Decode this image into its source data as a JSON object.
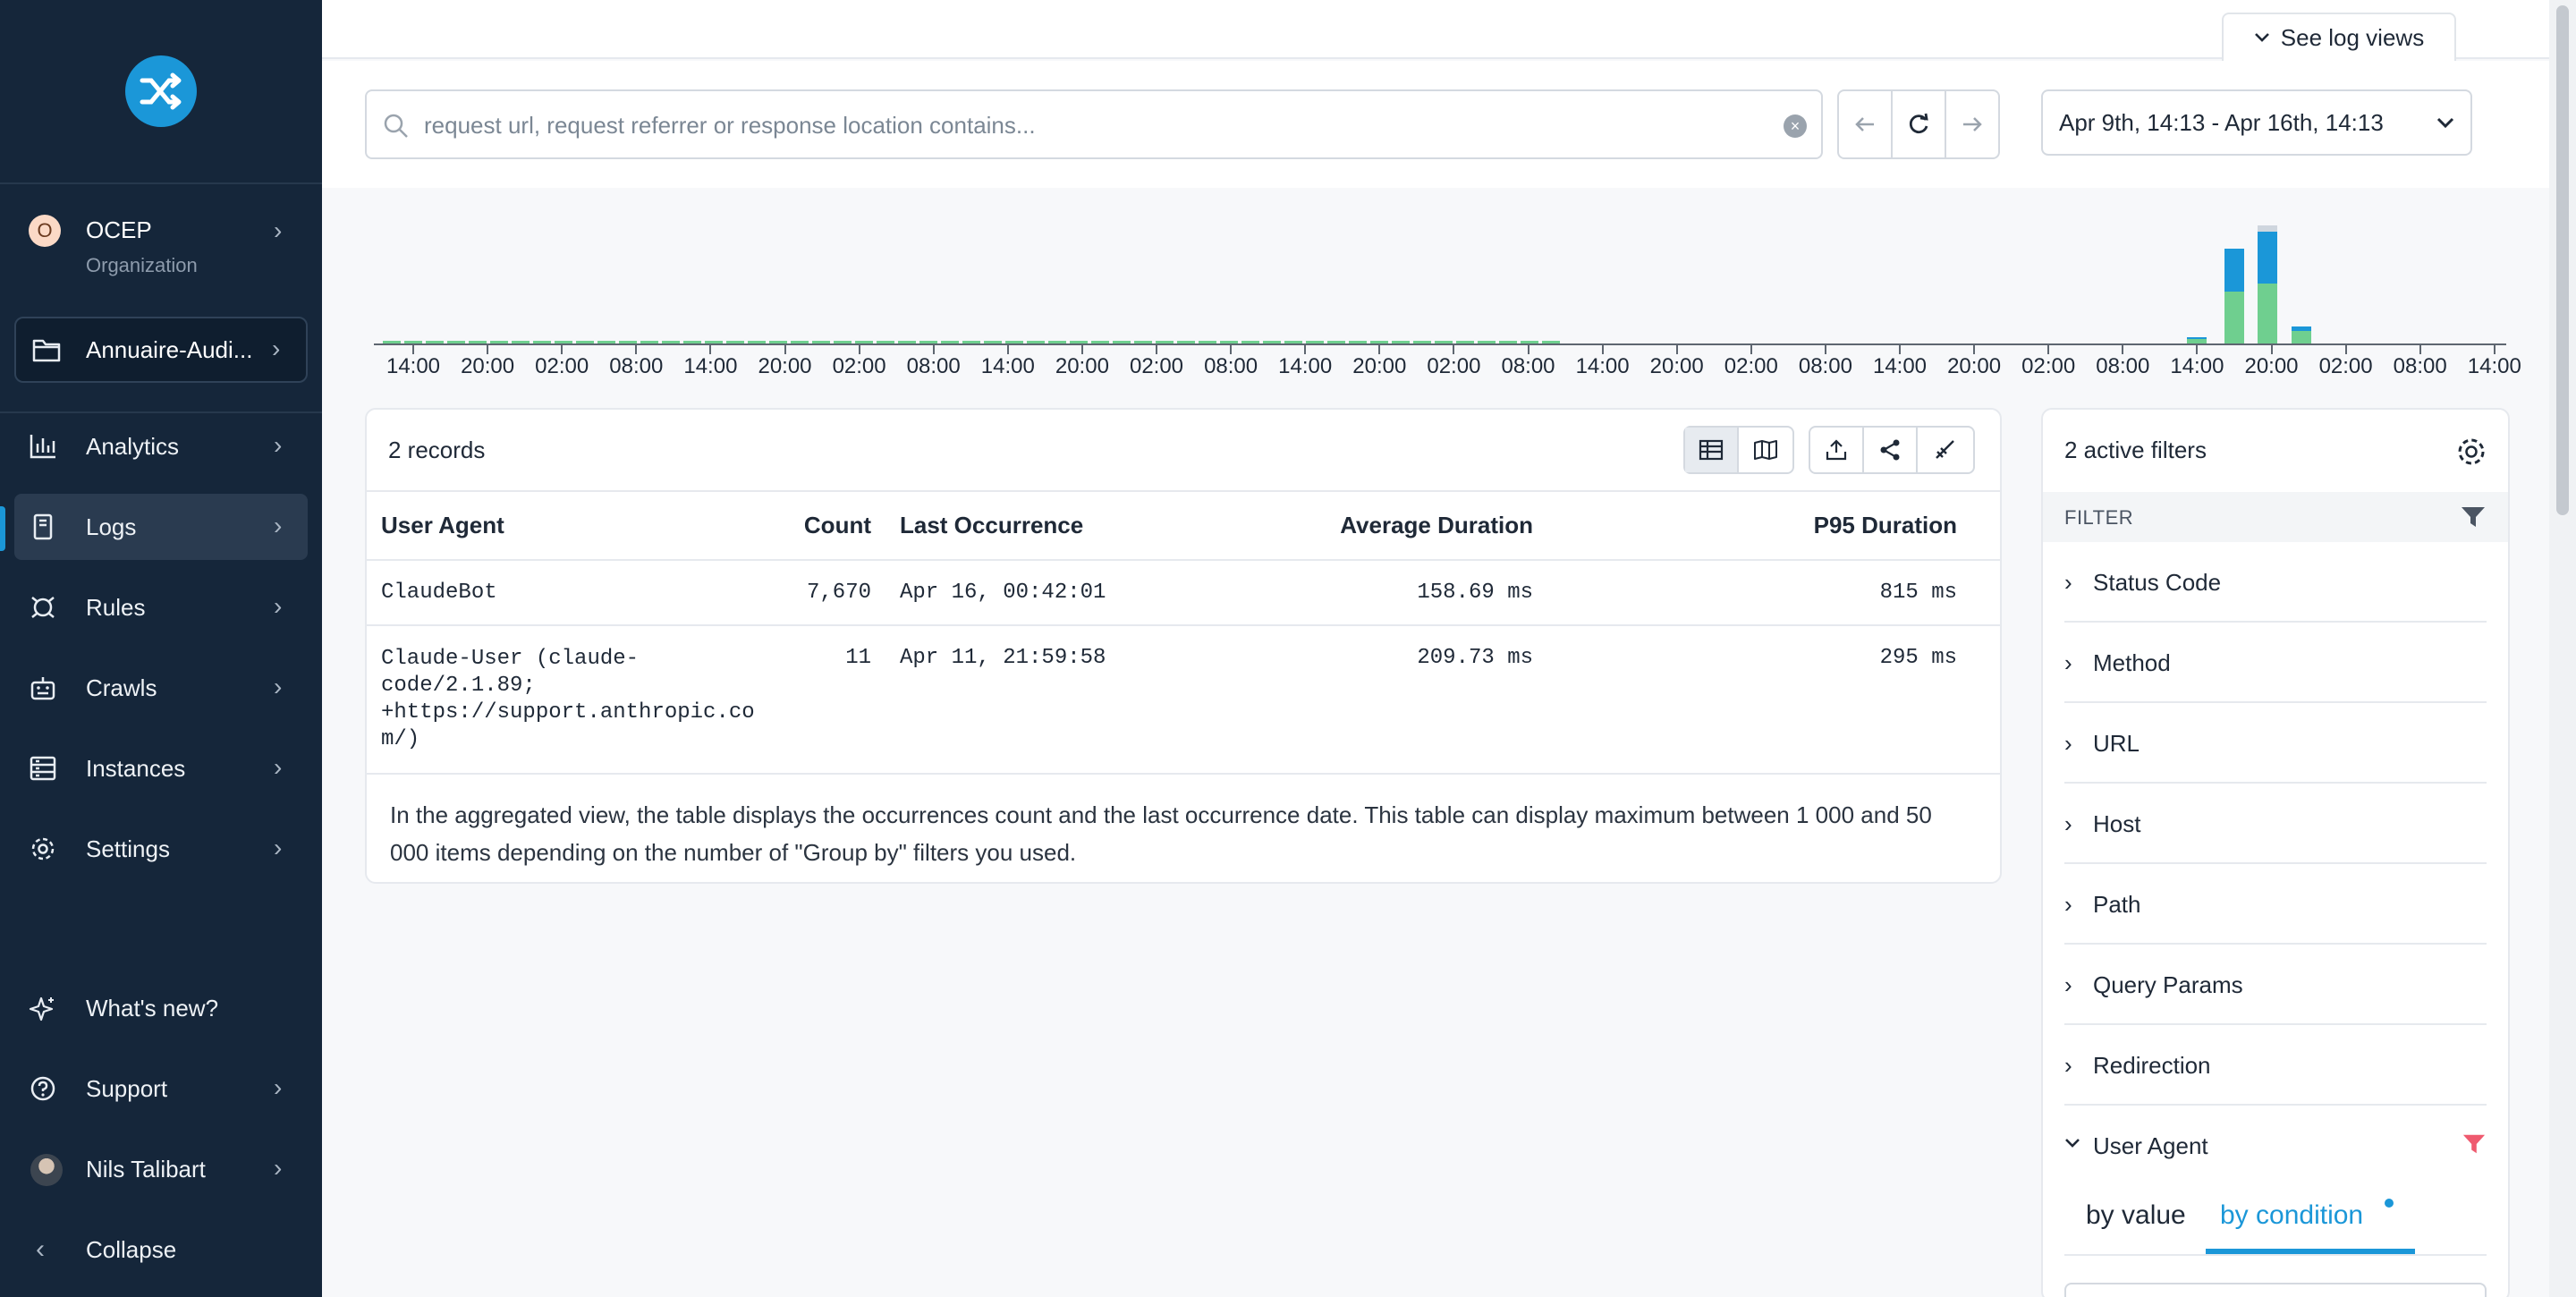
{
  "sidebar": {
    "org": {
      "badge": "O",
      "name": "OCEP",
      "sub": "Organization"
    },
    "project": {
      "label": "Annuaire-Audi..."
    },
    "items": [
      {
        "label": "Analytics",
        "icon": "bar-chart-icon"
      },
      {
        "label": "Logs",
        "icon": "log-file-icon"
      },
      {
        "label": "Rules",
        "icon": "rules-icon"
      },
      {
        "label": "Crawls",
        "icon": "robot-icon"
      },
      {
        "label": "Instances",
        "icon": "server-icon"
      },
      {
        "label": "Settings",
        "icon": "gear-icon"
      }
    ],
    "bottom": [
      {
        "label": "What's new?",
        "icon": "sparkle-icon"
      },
      {
        "label": "Support",
        "icon": "help-icon"
      },
      {
        "label": "Nils Talibart",
        "icon": "avatar"
      },
      {
        "label": "Collapse",
        "icon": "chevron-left-icon"
      }
    ]
  },
  "topbar": {
    "log_views": "See log views"
  },
  "search": {
    "placeholder": "request url, request referrer or response location contains...",
    "value": ""
  },
  "date_range": "Apr 9th, 14:13 - Apr 16th, 14:13",
  "histogram": {
    "tick_labels": [
      "14:00",
      "20:00",
      "02:00",
      "08:00",
      "14:00",
      "20:00",
      "02:00",
      "08:00",
      "14:00",
      "20:00",
      "02:00",
      "08:00",
      "14:00",
      "20:00",
      "02:00",
      "08:00",
      "14:00",
      "20:00",
      "02:00",
      "08:00",
      "14:00",
      "20:00",
      "02:00",
      "08:00",
      "14:00",
      "20:00",
      "02:00",
      "08:00",
      "14:00"
    ],
    "colors": {
      "green": "#6fcf8f",
      "blue": "#1b97d8",
      "gray": "#cfd6de"
    },
    "spikes": [
      {
        "tick": 24.0,
        "green": 0.04,
        "blue": 0.02
      },
      {
        "tick": 24.5,
        "green": 0.48,
        "blue": 0.4
      },
      {
        "tick": 24.95,
        "green": 0.56,
        "blue": 0.48,
        "gray": 0.06
      },
      {
        "tick": 25.4,
        "green": 0.12,
        "blue": 0.04
      }
    ]
  },
  "records": {
    "count_label": "2 records",
    "columns": [
      "User Agent",
      "Count",
      "Last Occurrence",
      "Average Duration",
      "P95 Duration"
    ],
    "rows": [
      {
        "ua": "ClaudeBot",
        "count": "7,670",
        "last": "Apr 16, 00:42:01",
        "avg": "158.69 ms",
        "p95": "815 ms"
      },
      {
        "ua": "Claude-User (claude-\ncode/2.1.89;\n+https://support.anthropic.co\nm/)",
        "count": "11",
        "last": "Apr 11, 21:59:58",
        "avg": "209.73 ms",
        "p95": "295 ms"
      }
    ],
    "footnote": "In the aggregated view, the table displays the occurrences count and the last occurrence date. This table can display maximum between 1 000 and 50 000 items depending on the number of \"Group by\" filters you used."
  },
  "filters": {
    "title": "2 active filters",
    "section": "FILTER",
    "items": [
      "Status Code",
      "Method",
      "URL",
      "Host",
      "Path",
      "Query Params",
      "Redirection",
      "User Agent"
    ],
    "tabs": [
      "by value",
      "by condition"
    ]
  }
}
